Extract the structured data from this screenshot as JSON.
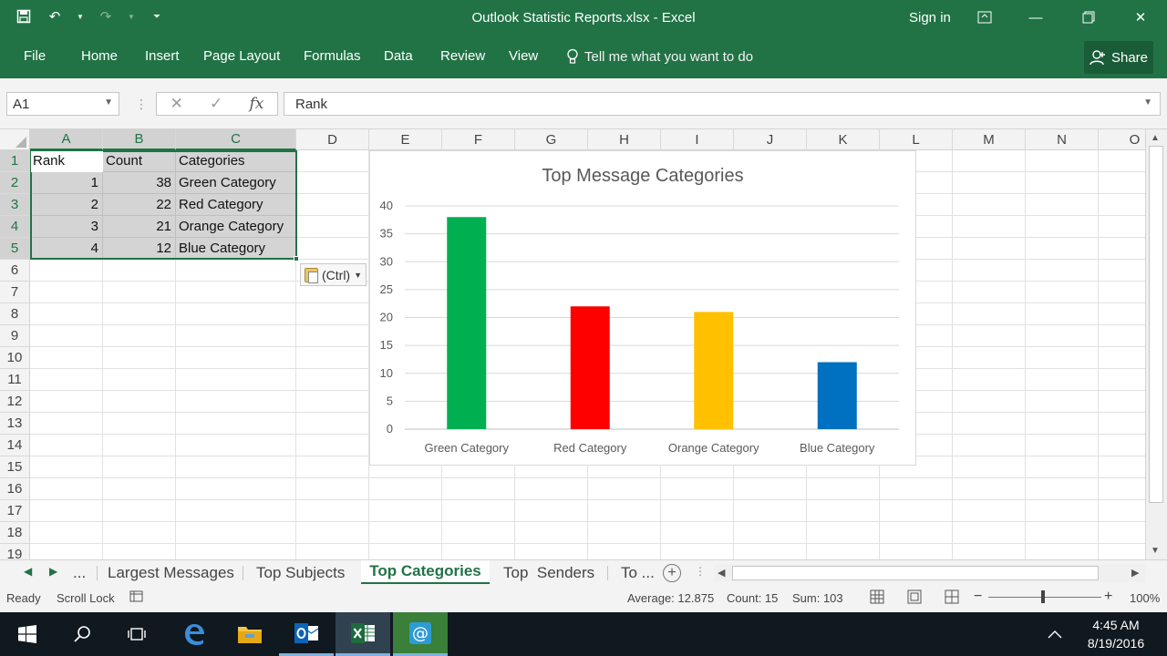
{
  "window": {
    "title": "Outlook Statistic Reports.xlsx - Excel",
    "sign_in": "Sign in"
  },
  "ribbon": {
    "tabs": [
      "File",
      "Home",
      "Insert",
      "Page Layout",
      "Formulas",
      "Data",
      "Review",
      "View"
    ],
    "tell_me": "Tell me what you want to do",
    "share": "Share"
  },
  "formula_bar": {
    "name_box": "A1",
    "content": "Rank",
    "fx": "fx"
  },
  "grid": {
    "columns": [
      "A",
      "B",
      "C",
      "D",
      "E",
      "F",
      "G",
      "H",
      "I",
      "J",
      "K",
      "L",
      "M",
      "N",
      "O"
    ],
    "rows": [
      "1",
      "2",
      "3",
      "4",
      "5",
      "6",
      "7",
      "8",
      "9",
      "10",
      "11",
      "12",
      "13",
      "14",
      "15",
      "16",
      "17",
      "18",
      "19"
    ],
    "cells": {
      "A1": "Rank",
      "B1": "Count",
      "C1": "Categories",
      "A2": "1",
      "B2": "38",
      "C2": "Green Category",
      "A3": "2",
      "B3": "22",
      "C3": "Red Category",
      "A4": "3",
      "B4": "21",
      "C4": "Orange Category",
      "A5": "4",
      "B5": "12",
      "C5": "Blue Category"
    },
    "paste_options": "(Ctrl)"
  },
  "chart_data": {
    "type": "bar",
    "title": "Top Message Categories",
    "categories": [
      "Green Category",
      "Red Category",
      "Orange Category",
      "Blue Category"
    ],
    "values": [
      38,
      22,
      21,
      12
    ],
    "colors": [
      "#00B050",
      "#FF0000",
      "#FFC000",
      "#0070C0"
    ],
    "ylim": [
      0,
      40
    ],
    "yticks": [
      0,
      5,
      10,
      15,
      20,
      25,
      30,
      35,
      40
    ],
    "grid": true,
    "xlabel": "",
    "ylabel": ""
  },
  "sheets": {
    "more": "...",
    "tabs": [
      "Largest Messages",
      "Top Subjects",
      "Top Categories",
      "Top  Senders",
      "To ..."
    ],
    "active": "Top Categories"
  },
  "status": {
    "ready": "Ready",
    "scroll_lock": "Scroll Lock",
    "average": "Average: 12.875",
    "count": "Count: 15",
    "sum": "Sum: 103",
    "zoom": "100%"
  },
  "taskbar": {
    "time": "4:45 AM",
    "date": "8/19/2016"
  },
  "colors": {
    "excel_green": "#217346",
    "taskbar": "#101820"
  }
}
